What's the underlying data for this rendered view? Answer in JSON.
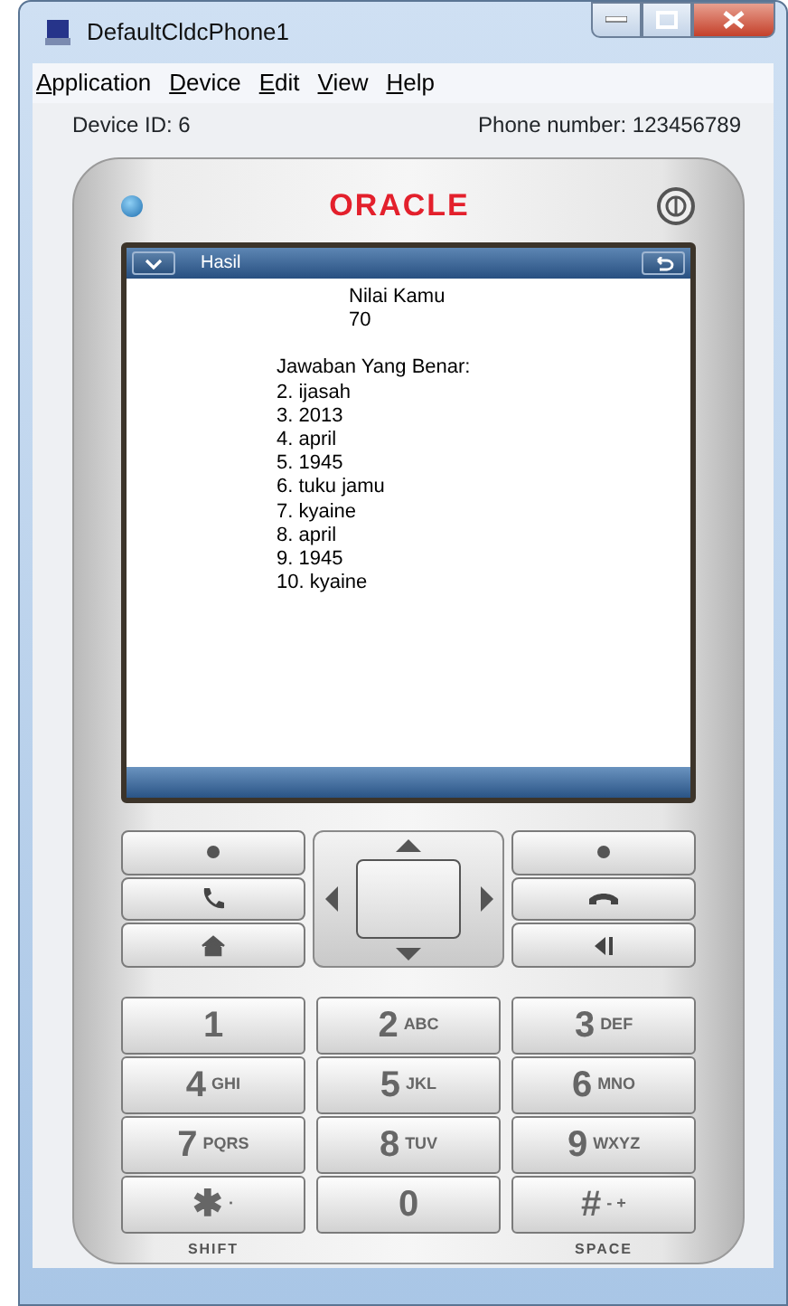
{
  "window": {
    "title": "DefaultCldcPhone1"
  },
  "menu": [
    "Application",
    "Device",
    "Edit",
    "View",
    "Help"
  ],
  "device_info": {
    "device_id": "Device ID: 6",
    "phone_number": "Phone number:  123456789"
  },
  "phone": {
    "brand": "ORACLE",
    "screen": {
      "title": "Hasil",
      "score": {
        "label": "Nilai Kamu",
        "value": "70"
      },
      "answers": {
        "heading": "Jawaban Yang Benar:",
        "items": [
          "2. ijasah",
          "3. 2013",
          "4. april",
          "5. 1945",
          "6. tuku jamu",
          "7. kyaine",
          "8. april",
          "9. 1945",
          "10. kyaine"
        ]
      }
    },
    "keypad": [
      {
        "digit": "1"
      },
      {
        "digit": "2",
        "letters": "ABC"
      },
      {
        "digit": "3",
        "letters": "DEF"
      },
      {
        "digit": "4",
        "letters": "GHI"
      },
      {
        "digit": "5",
        "letters": "JKL"
      },
      {
        "digit": "6",
        "letters": "MNO"
      },
      {
        "digit": "7",
        "letters": "PQRS"
      },
      {
        "digit": "8",
        "letters": "TUV"
      },
      {
        "digit": "9",
        "letters": "WXYZ"
      },
      {
        "digit": "✱",
        "letters": "·",
        "caption": "SHIFT"
      },
      {
        "digit": "0"
      },
      {
        "digit": "#",
        "letters": "- +",
        "caption": "SPACE"
      }
    ]
  }
}
